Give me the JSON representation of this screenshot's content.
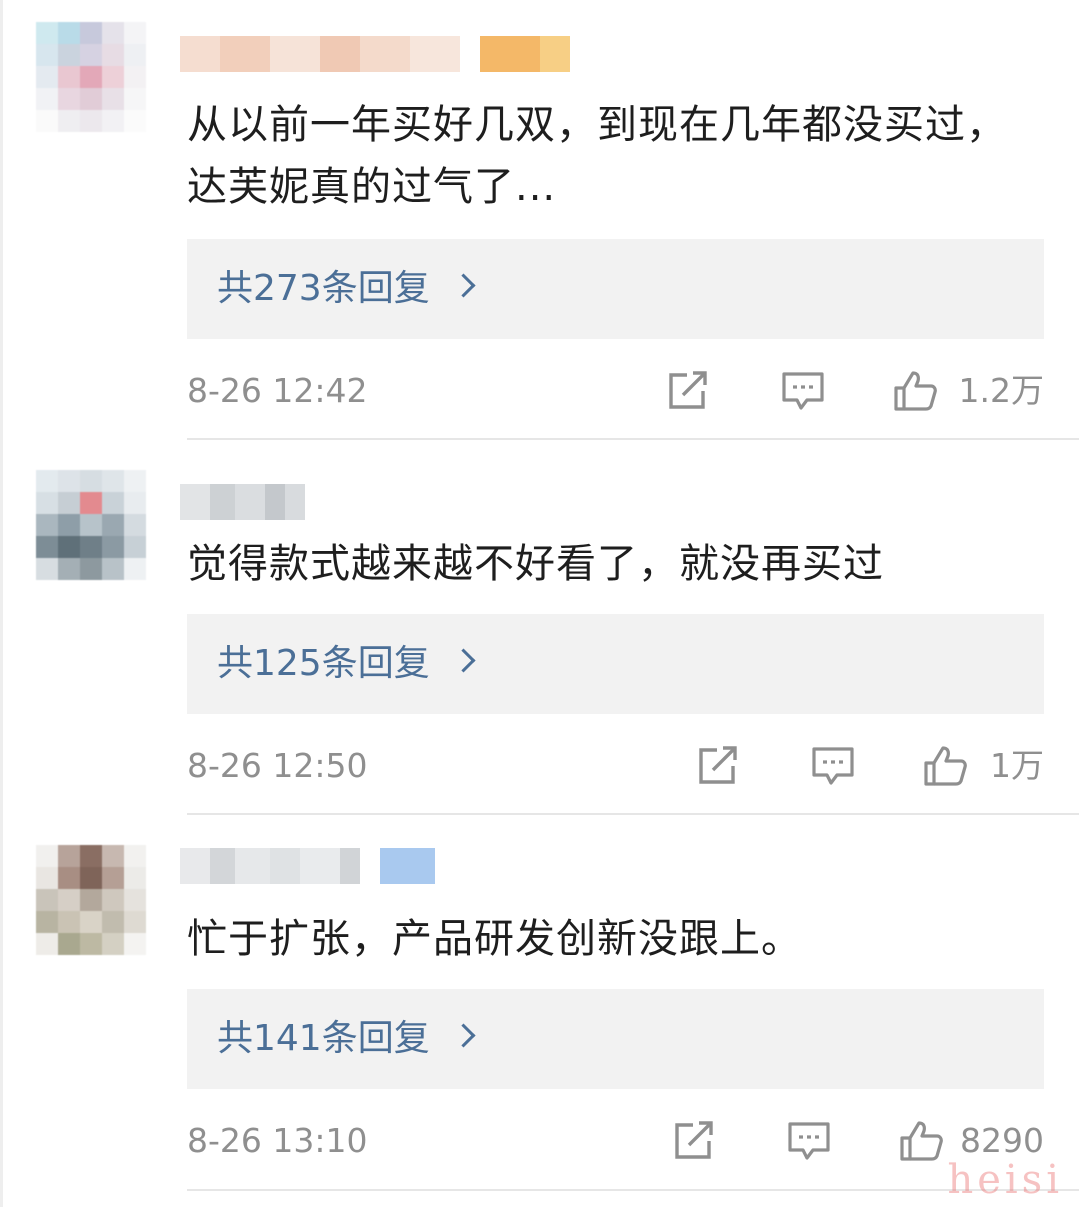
{
  "comments": [
    {
      "text": "从以前一年买好几双，到现在几年都没买过，达芙妮真的过气了...",
      "reply_label": "共273条回复",
      "time": "8-26 12:42",
      "likes": "1.2万"
    },
    {
      "text": "觉得款式越来越不好看了，就没再买过",
      "reply_label": "共125条回复",
      "time": "8-26 12:50",
      "likes": "1万"
    },
    {
      "text": "忙于扩张，产品研发创新没跟上。",
      "reply_label": "共141条回复",
      "time": "8-26 13:10",
      "likes": "8290"
    }
  ],
  "icons": {
    "share": "share-icon",
    "comment": "comment-icon",
    "like": "thumbs-up-icon",
    "reply_arrow": "chevron-right-icon"
  },
  "colors": {
    "reply_link": "#4b6f97",
    "meta_text": "#8f8f8f",
    "reply_bg": "#f2f2f2"
  },
  "watermark": "heisi"
}
